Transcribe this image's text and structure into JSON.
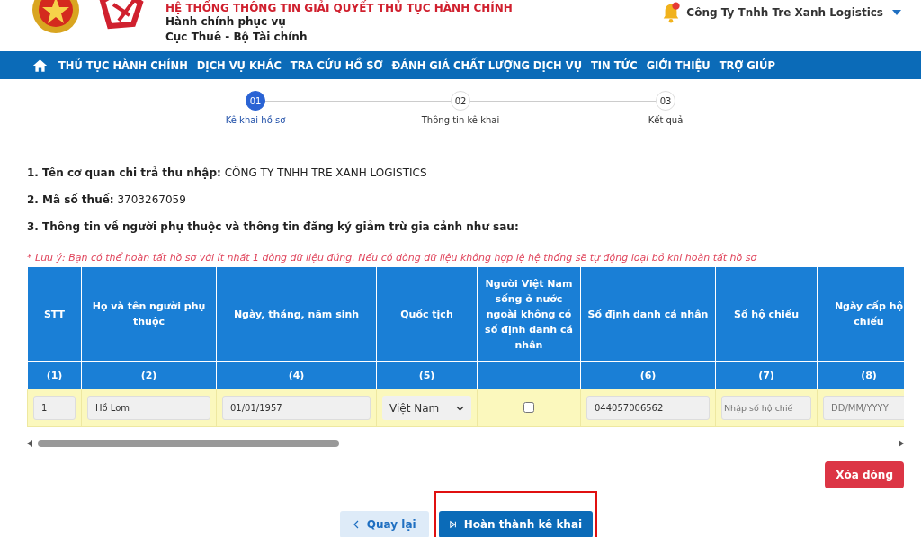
{
  "header": {
    "system_title": "HỆ THỐNG THÔNG TIN GIẢI QUYẾT THỦ TỤC HÀNH CHÍNH",
    "subtitle": "Hành chính phục vụ",
    "agency": "Cục Thuế - Bộ Tài chính",
    "user": "Công Ty Tnhh Tre Xanh Logistics"
  },
  "nav": [
    {
      "label": "THỦ TỤC HÀNH CHÍNH"
    },
    {
      "label": "DỊCH VỤ KHÁC"
    },
    {
      "label": "TRA CỨU HỒ SƠ"
    },
    {
      "label": "ĐÁNH GIÁ CHẤT LƯỢNG DỊCH VỤ"
    },
    {
      "label": "TIN TỨC"
    },
    {
      "label": "GIỚI THIỆU"
    },
    {
      "label": "TRỢ GIÚP"
    }
  ],
  "steps": [
    {
      "number": "01",
      "label": "Kê khai hồ sơ",
      "selected": true
    },
    {
      "number": "02",
      "label": "Thông tin kê khai",
      "selected": false
    },
    {
      "number": "03",
      "label": "Kết quả",
      "selected": false
    }
  ],
  "info": [
    {
      "label": "1. Tên cơ quan chi trả thu nhập:",
      "value": "CÔNG TY TNHH TRE XANH LOGISTICS"
    },
    {
      "label": "2. Mã số thuế:",
      "value": "3703267059"
    },
    {
      "label": "3. Thông tin về người phụ thuộc và thông tin đăng ký giảm trừ gia cảnh như sau:"
    }
  ],
  "note": "* Lưu ý: Bạn có thể hoàn tất hồ sơ với ít nhất 1 dòng dữ liệu đúng. Nếu có dòng dữ liệu không hợp lệ hệ thống sẽ tự động loại bỏ khi hoàn tất hồ sơ",
  "table": {
    "columns": [
      {
        "title": "STT",
        "number": "(1)"
      },
      {
        "title": "Họ và tên người phụ thuộc",
        "number": "(2)"
      },
      {
        "title": "Ngày, tháng, năm sinh",
        "number": "(4)"
      },
      {
        "title": "Quốc tịch",
        "number": "(5)"
      },
      {
        "title": "Người Việt Nam sống ở nước ngoài không có số định danh cá nhân"
      },
      {
        "title": "Số định danh cá nhân",
        "number": "(6)"
      },
      {
        "title": "Số hộ chiếu",
        "number": "(7)"
      },
      {
        "title": "Ngày cấp hộ chiếu",
        "number": "(8)"
      }
    ],
    "rows": [
      {
        "cells": [
          {
            "kind": "input",
            "value": "1"
          },
          {
            "kind": "input",
            "value": "Hồ Lom"
          },
          {
            "kind": "input",
            "value": "01/01/1957"
          },
          {
            "kind": "select",
            "value": "Việt Nam"
          },
          {
            "kind": "checkbox",
            "checked": false
          },
          {
            "kind": "input",
            "value": "044057006562"
          },
          {
            "kind": "input",
            "placeholder": "Nhập số hộ chiế"
          },
          {
            "kind": "input",
            "placeholder": "DD/MM/YYYY"
          }
        ]
      }
    ]
  },
  "delete_button": "Xóa dòng",
  "buttons": {
    "back": "Quay lại",
    "finish": "Hoàn thành kê khai"
  }
}
